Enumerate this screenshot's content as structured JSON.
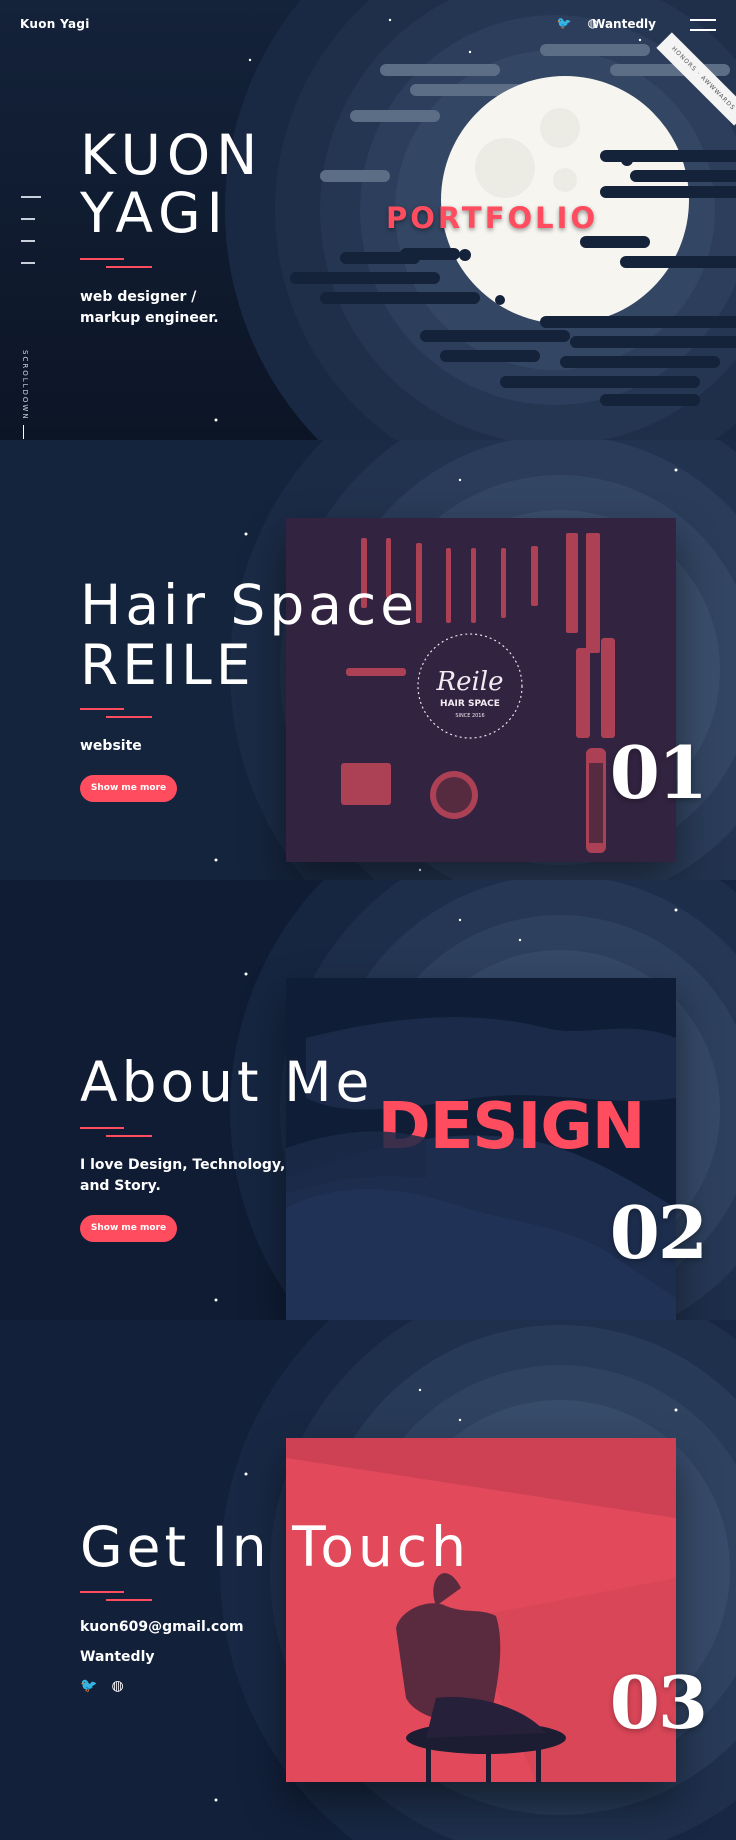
{
  "header": {
    "brand": "Kuon Yagi",
    "twitter_icon": "twitter-icon",
    "dribbble_icon": "dribbble-icon",
    "wantedly": "Wantedly",
    "menu_icon": "menu-icon",
    "ribbon": "HONORS · AWWWARDS"
  },
  "side_nav": {
    "scrolldown": "SCROLLDOWN"
  },
  "hero": {
    "title_line1": "KUON",
    "title_line2": "YAGI",
    "subtitle_line1": "web designer /",
    "subtitle_line2": "markup engineer.",
    "portfolio": "PORTFOLIO"
  },
  "works": [
    {
      "title_line1": "Hair Space",
      "title_line2": "REILE",
      "subtitle": "website",
      "button": "Show me more",
      "number": "01",
      "logo_name": "Reile",
      "logo_sub": "HAIR SPACE",
      "logo_since": "SINCE 2016"
    },
    {
      "title_line1": "About Me",
      "subtitle_line1": "I love Design, Technology,",
      "subtitle_line2": "and Story.",
      "button": "Show me more",
      "number": "02",
      "overlay_word": "DESIGN"
    },
    {
      "title_line1": "Get In Touch",
      "email": "kuon609@gmail.com",
      "wantedly": "Wantedly",
      "number": "03"
    }
  ],
  "colors": {
    "accent": "#ff4d5f",
    "bg_dark": "#0e1a2e",
    "ring": "#2a3a56"
  }
}
